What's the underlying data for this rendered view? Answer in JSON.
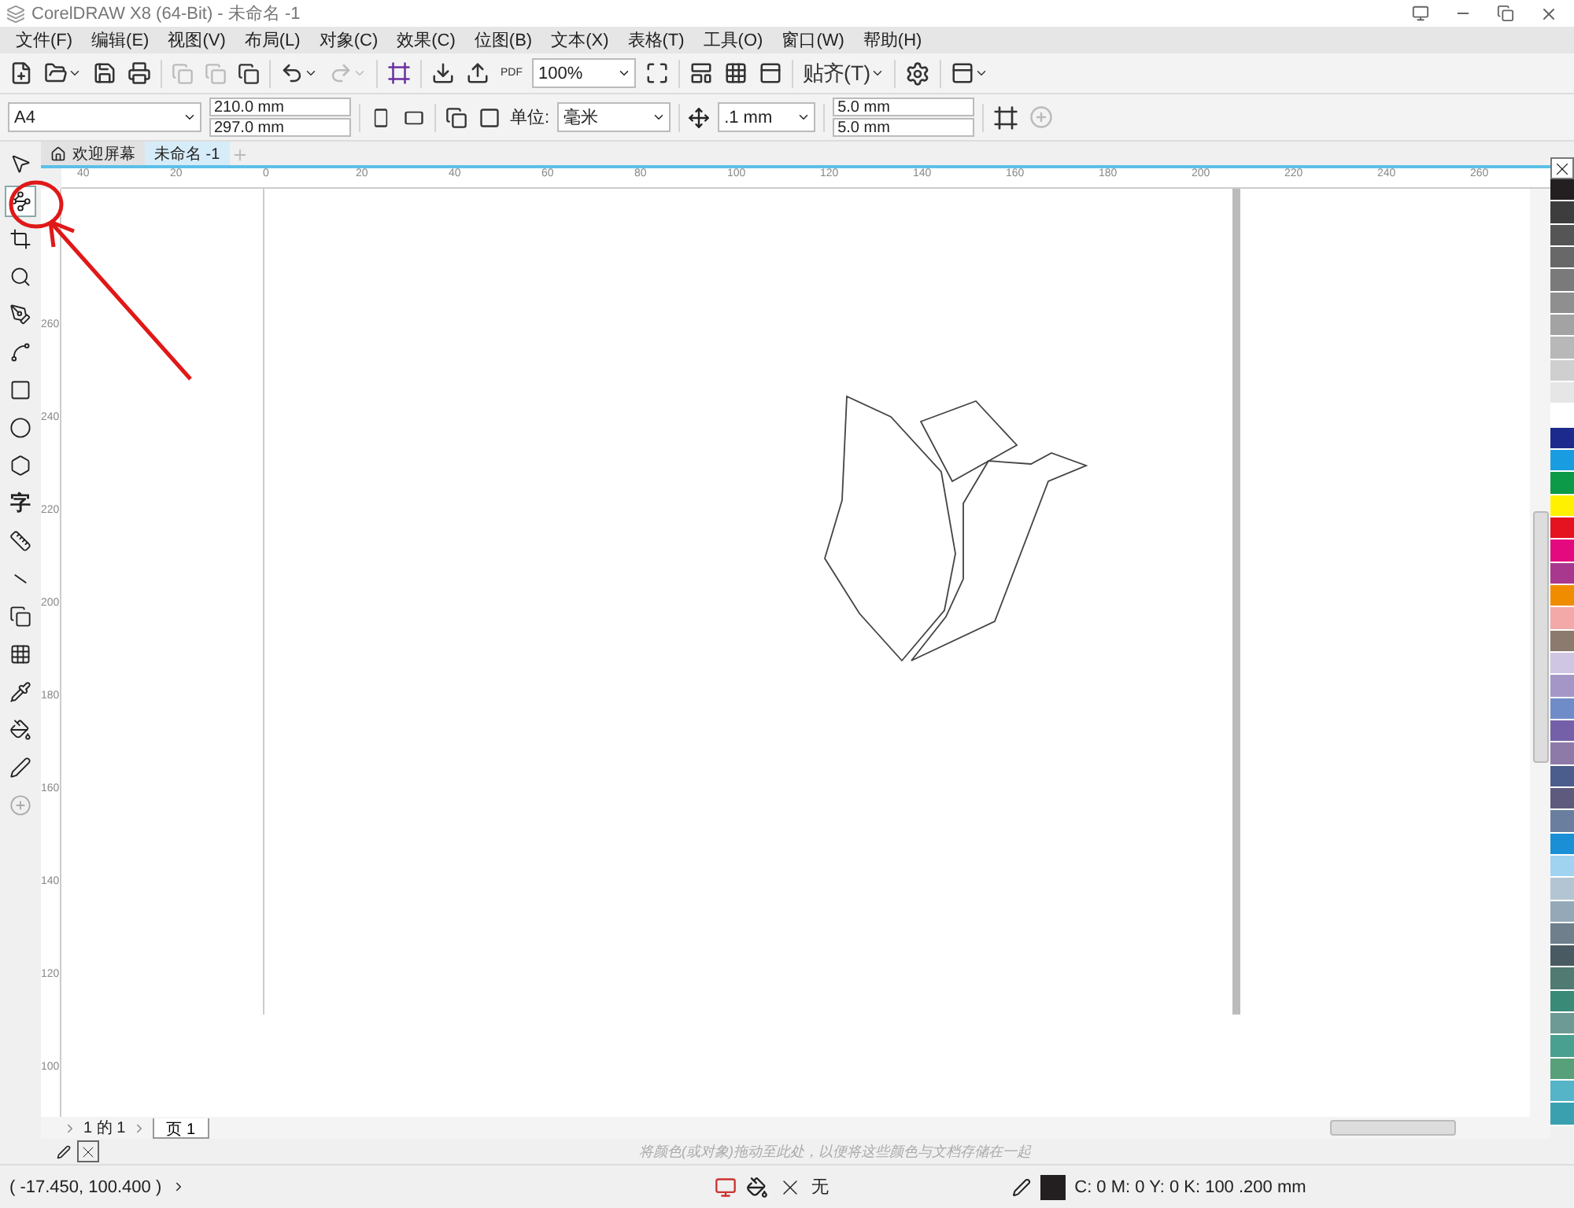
{
  "window": {
    "title": "CorelDRAW X8 (64-Bit) - 未命名 -1"
  },
  "menu": [
    "文件(F)",
    "编辑(E)",
    "视图(V)",
    "布局(L)",
    "对象(C)",
    "效果(C)",
    "位图(B)",
    "文本(X)",
    "表格(T)",
    "工具(O)",
    "窗口(W)",
    "帮助(H)"
  ],
  "toolbar": {
    "zoom": "100%",
    "snap": "贴齐(T)",
    "pdf": "PDF"
  },
  "property_bar": {
    "page_size": "A4",
    "width": "210.0 mm",
    "height": "297.0 mm",
    "units_label": "单位:",
    "units": "毫米",
    "nudge": ".1 mm",
    "dup_x": "5.0 mm",
    "dup_y": "5.0 mm"
  },
  "tabs": [
    {
      "label": "欢迎屏幕",
      "kind": "home",
      "selected": false
    },
    {
      "label": "未命名 -1",
      "kind": "doc",
      "selected": true
    }
  ],
  "ruler_h": [
    "40",
    "20",
    "0",
    "20",
    "40",
    "60",
    "80",
    "100",
    "120",
    "140",
    "160",
    "180",
    "200",
    "220",
    "240",
    "260"
  ],
  "ruler_v": [
    "260",
    "240",
    "220",
    "200",
    "180",
    "160",
    "140",
    "120",
    "100"
  ],
  "tools": [
    {
      "kind": "pick",
      "selected": false
    },
    {
      "kind": "shape",
      "selected": true
    },
    {
      "kind": "crop",
      "selected": false
    },
    {
      "kind": "zoom",
      "selected": false
    },
    {
      "kind": "freehand",
      "selected": false
    },
    {
      "kind": "artistic",
      "selected": false
    },
    {
      "kind": "rect",
      "selected": false
    },
    {
      "kind": "ellipse",
      "selected": false
    },
    {
      "kind": "polygon",
      "selected": false
    },
    {
      "kind": "text",
      "label": "字",
      "selected": false
    },
    {
      "kind": "dimension",
      "selected": false
    },
    {
      "kind": "connector",
      "selected": false
    },
    {
      "kind": "shadow",
      "selected": false
    },
    {
      "kind": "transparency",
      "selected": false
    },
    {
      "kind": "eyedropper",
      "selected": false
    },
    {
      "kind": "fill",
      "selected": false
    },
    {
      "kind": "outline",
      "selected": false
    },
    {
      "kind": "add",
      "selected": false
    }
  ],
  "page_nav": {
    "pages": "1 的 1",
    "page_tab": "页 1"
  },
  "doc_palette": {
    "hint": "将颜色(或对象)拖动至此处，以便将这些颜色与文档存储在一起"
  },
  "palette": [
    {
      "color": "#231f20"
    },
    {
      "color": "#3d3d3d"
    },
    {
      "color": "#555555"
    },
    {
      "color": "#686868"
    },
    {
      "color": "#7a7a7a"
    },
    {
      "color": "#8f8f8f"
    },
    {
      "color": "#a3a3a3"
    },
    {
      "color": "#b8b8b8"
    },
    {
      "color": "#cfcfcf"
    },
    {
      "color": "#e6e6e6"
    },
    {
      "color": "#ffffff"
    },
    {
      "color": "#1b2a8c"
    },
    {
      "color": "#1a9de0"
    },
    {
      "color": "#0d9a48"
    },
    {
      "color": "#fff100"
    },
    {
      "color": "#e5131f"
    },
    {
      "color": "#e5097f"
    },
    {
      "color": "#a8388d"
    },
    {
      "color": "#f08c00"
    },
    {
      "color": "#f2a9a8"
    },
    {
      "color": "#8b7a6d"
    },
    {
      "color": "#cfc6e3"
    },
    {
      "color": "#a596c8"
    },
    {
      "color": "#6f8cc9"
    },
    {
      "color": "#7460a8"
    },
    {
      "color": "#8e7aa8"
    },
    {
      "color": "#4b5d8c"
    },
    {
      "color": "#5e5a7e"
    },
    {
      "color": "#6a7fa0"
    },
    {
      "color": "#1a8fd6"
    },
    {
      "color": "#9fd3f0"
    },
    {
      "color": "#b3c5d3"
    },
    {
      "color": "#95a8b8"
    },
    {
      "color": "#6f7f8c"
    },
    {
      "color": "#4a5a63"
    },
    {
      "color": "#507a72"
    },
    {
      "color": "#3a8a78"
    },
    {
      "color": "#6e9a95"
    },
    {
      "color": "#4aa090"
    },
    {
      "color": "#58a07a"
    },
    {
      "color": "#55b4c8"
    },
    {
      "color": "#3aa0b0"
    }
  ],
  "status_bar": {
    "coords": "( -17.450, 100.400 )",
    "fill": "无",
    "outline": "C: 0 M: 0 Y: 0 K: 100  .200 mm"
  }
}
